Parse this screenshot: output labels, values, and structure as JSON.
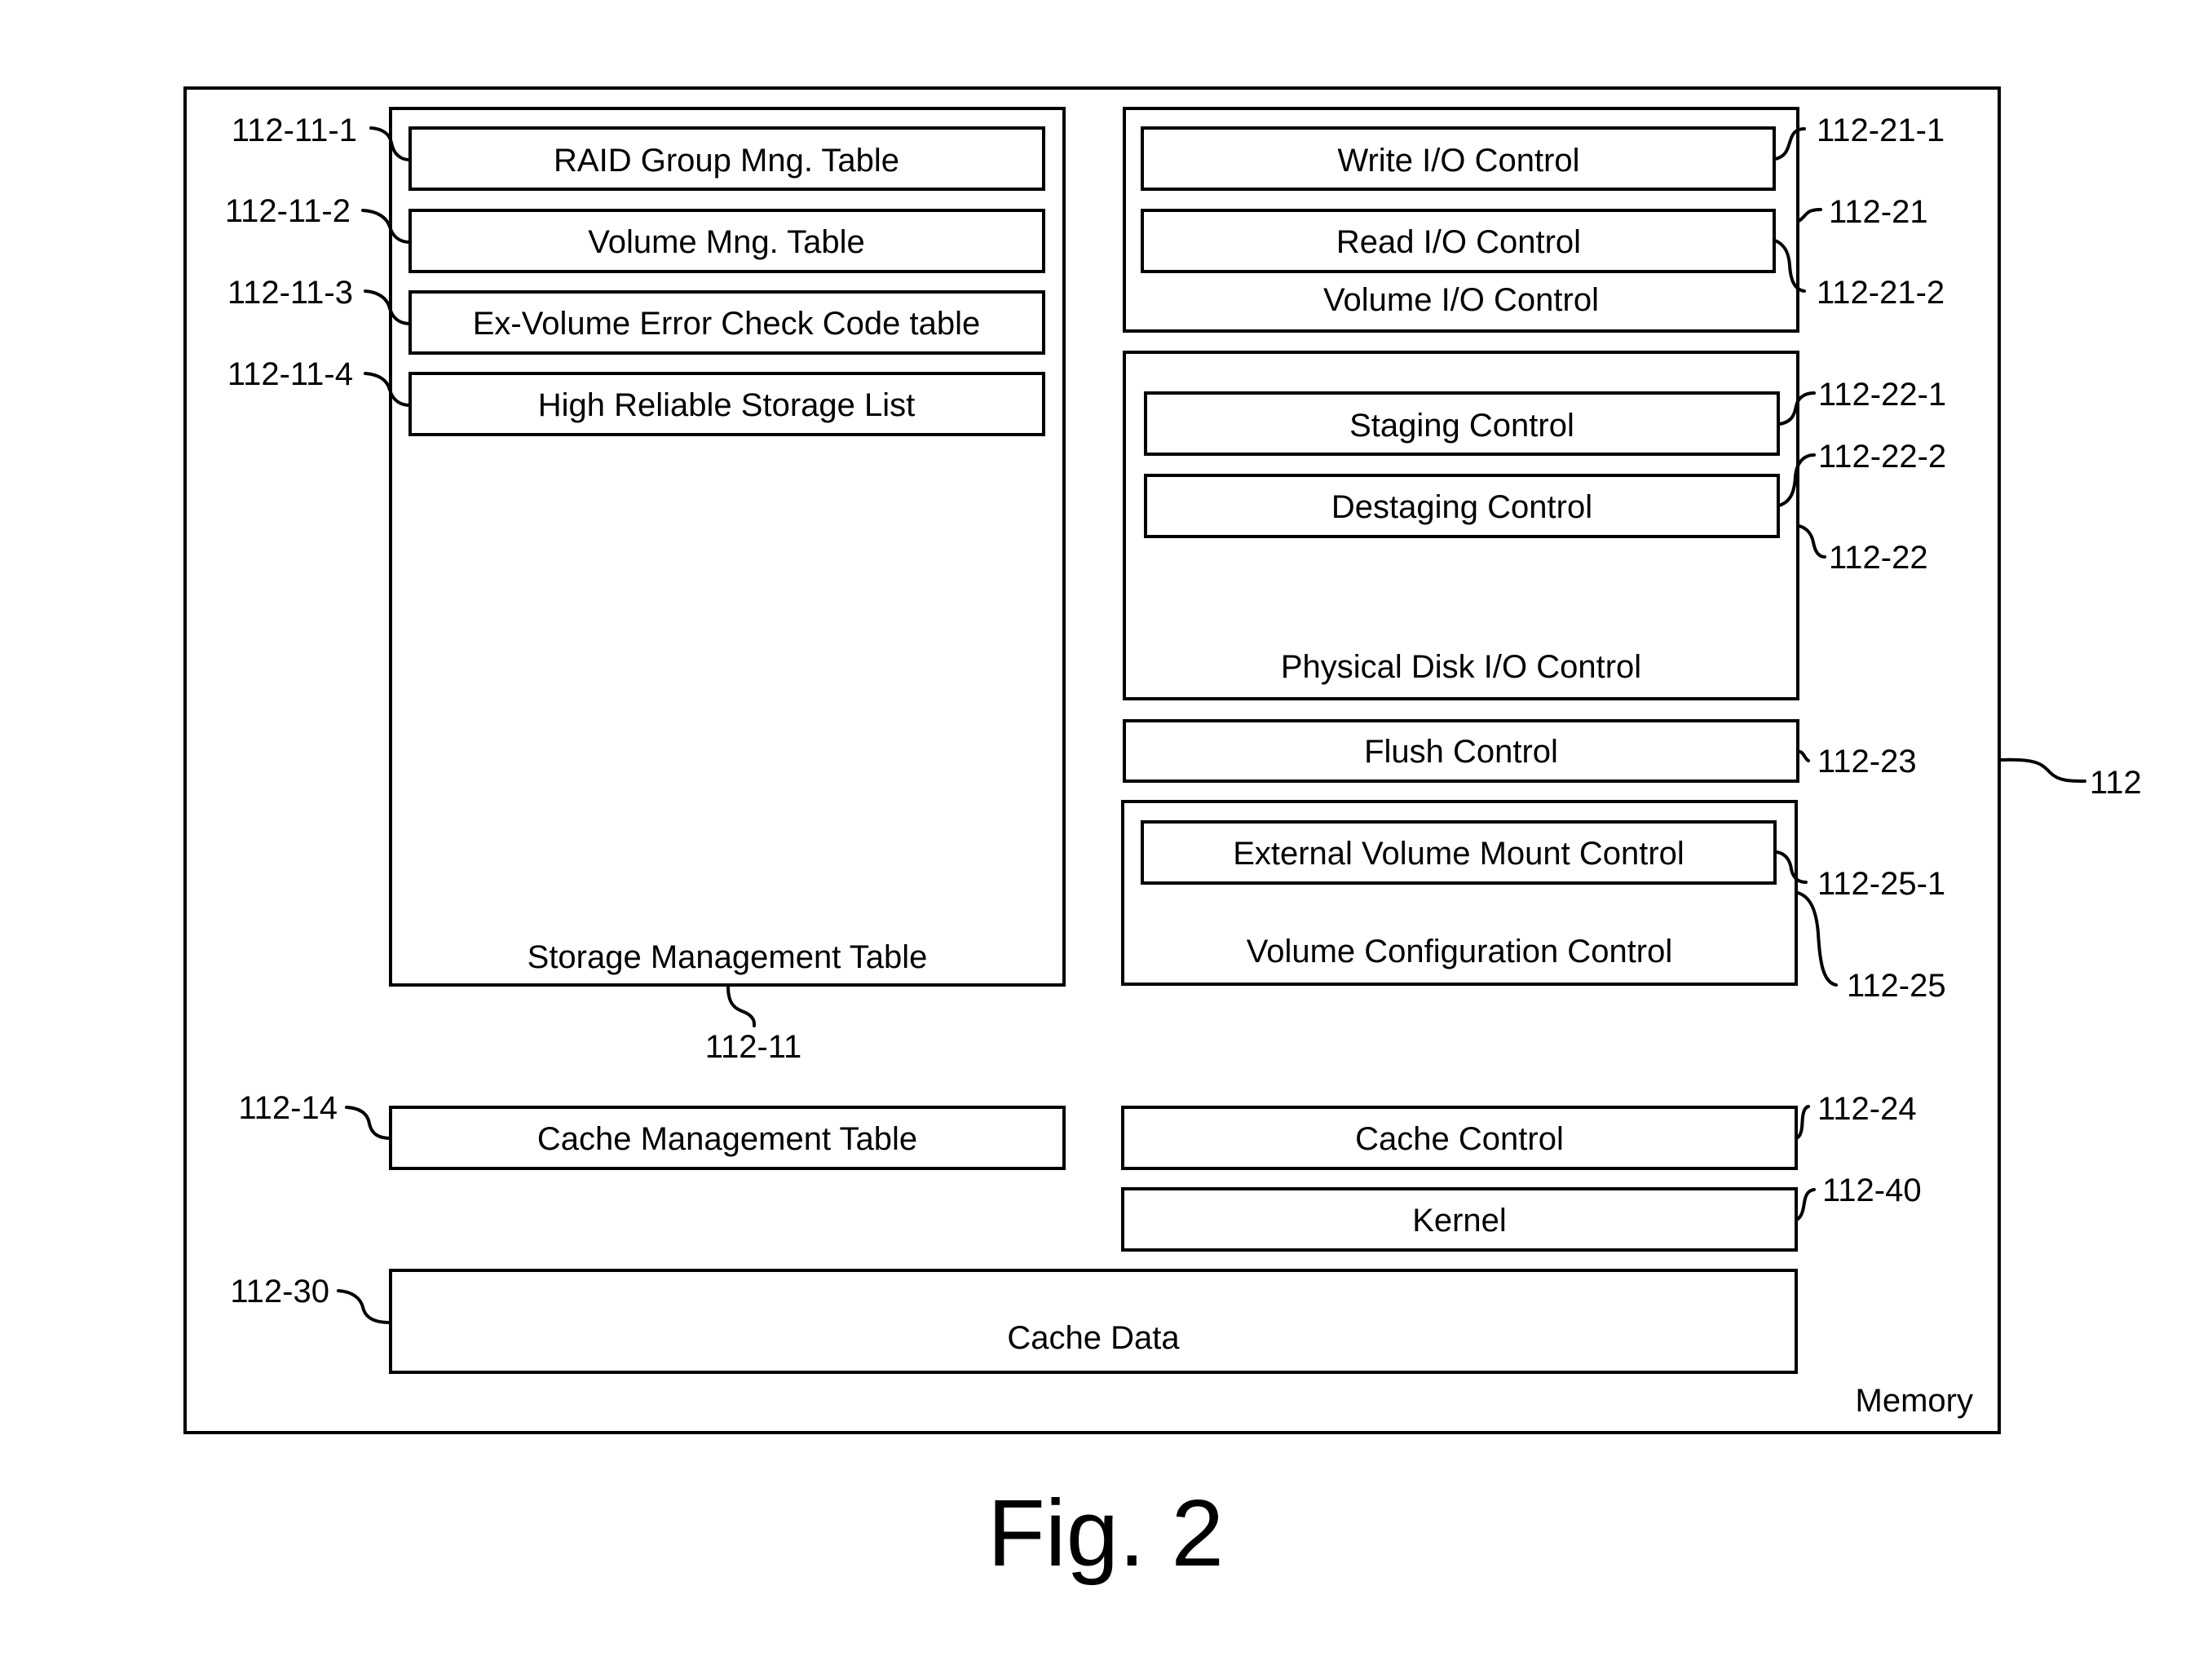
{
  "figure": {
    "caption": "Fig. 2",
    "memory": {
      "label": "Memory",
      "ref": "112"
    },
    "storage_management_table": {
      "label": "Storage Management Table",
      "ref": "112-11",
      "items": [
        {
          "label": "RAID Group Mng. Table",
          "ref": "112-11-1"
        },
        {
          "label": "Volume Mng. Table",
          "ref": "112-11-2"
        },
        {
          "label": "Ex-Volume Error Check Code table",
          "ref": "112-11-3"
        },
        {
          "label": "High Reliable Storage List",
          "ref": "112-11-4"
        }
      ]
    },
    "volume_io_control": {
      "label": "Volume I/O Control",
      "ref": "112-21",
      "items": [
        {
          "label": "Write I/O Control",
          "ref": "112-21-1"
        },
        {
          "label": "Read I/O Control",
          "ref": "112-21-2"
        }
      ]
    },
    "physical_disk_io_control": {
      "label": "Physical Disk I/O Control",
      "ref": "112-22",
      "items": [
        {
          "label": "Staging Control",
          "ref": "112-22-1"
        },
        {
          "label": "Destaging Control",
          "ref": "112-22-2"
        }
      ]
    },
    "flush_control": {
      "label": "Flush Control",
      "ref": "112-23"
    },
    "volume_configuration_control": {
      "label": "Volume Configuration Control",
      "ref": "112-25",
      "items": [
        {
          "label": "External Volume Mount Control",
          "ref": "112-25-1"
        }
      ]
    },
    "cache_management_table": {
      "label": "Cache Management Table",
      "ref": "112-14"
    },
    "cache_control": {
      "label": "Cache Control",
      "ref": "112-24"
    },
    "kernel": {
      "label": "Kernel",
      "ref": "112-40"
    },
    "cache_data": {
      "label": "Cache Data",
      "ref": "112-30"
    }
  }
}
